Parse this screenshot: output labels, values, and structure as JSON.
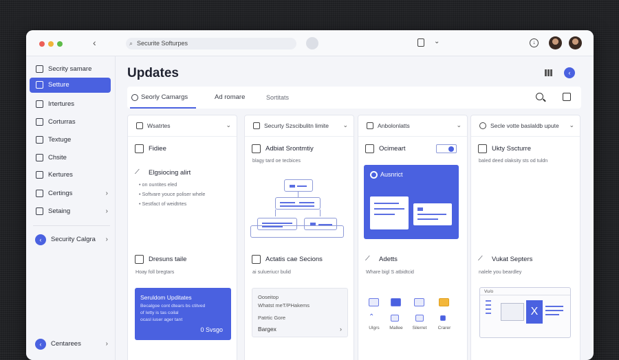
{
  "search": {
    "placeholder": "Securite Softurpes"
  },
  "sidebar": {
    "items": [
      {
        "label": "Secrity samare"
      },
      {
        "label": "Setture"
      },
      {
        "label": "Irtertures"
      },
      {
        "label": "Corturras"
      },
      {
        "label": "Textuge"
      },
      {
        "label": "Chsite"
      },
      {
        "label": "Kertures"
      },
      {
        "label": "Certings"
      },
      {
        "label": "Setaing"
      },
      {
        "label": "Security Calgra"
      },
      {
        "label": "Centarees"
      }
    ]
  },
  "main": {
    "title": "Updates",
    "tabs": [
      {
        "label": "Seorly Camargs"
      },
      {
        "label": "Ad romare"
      },
      {
        "label": "Sortitats"
      }
    ]
  },
  "columns": [
    {
      "header": "Wsatrtes",
      "sec1_title": "Fidiee",
      "sec2_title": "Elgsiocing alirt",
      "bullets": [
        "on ountites eled",
        "Softvare youce poliser whele",
        "Sestfact of weidtrtes"
      ],
      "sec3_title": "Dresuns taile",
      "sec3_sub": "Hoay foll bregtars",
      "card_title": "Seruldom Upditates",
      "card_lines": [
        "Becalgoe cont dtears bs ctitved",
        "of Ietty is tas coilal",
        "ocasl iuser ager tant"
      ],
      "card_footer": "0 Svsgo"
    },
    {
      "header": "Securty Szscibulitn limite",
      "sec1_title": "Adbiat Srontmtiy",
      "sec1_sub": "blagy tard oe tecbices",
      "sec3_title": "Actatis cae Secions",
      "sec3_sub": "ai sulueriucr bulid",
      "grey": [
        "Ooseitop",
        "Whatst meT/PHakems",
        "Patrtic Gore",
        "Bargex",
        "›"
      ]
    },
    {
      "header": "Anbolonlatts",
      "sec1_title": "Ocimeart",
      "card_title": "Ausnrict",
      "sec3_title": "Adetts",
      "sec3_sub": "Whare bigl S atbidtcid",
      "icons": [
        "Ulgrs",
        "Mallee",
        "Silerret",
        "Crarer"
      ]
    },
    {
      "header": "Secle votte baslaldb upute",
      "sec1_title": "Ukty Sscturre",
      "sec1_sub": "baled deed olaksity sts od tuldn",
      "sec3_title": "Vukat Septers",
      "sec3_sub": "nalele you beardley",
      "win_label": "Vu/o"
    }
  ]
}
